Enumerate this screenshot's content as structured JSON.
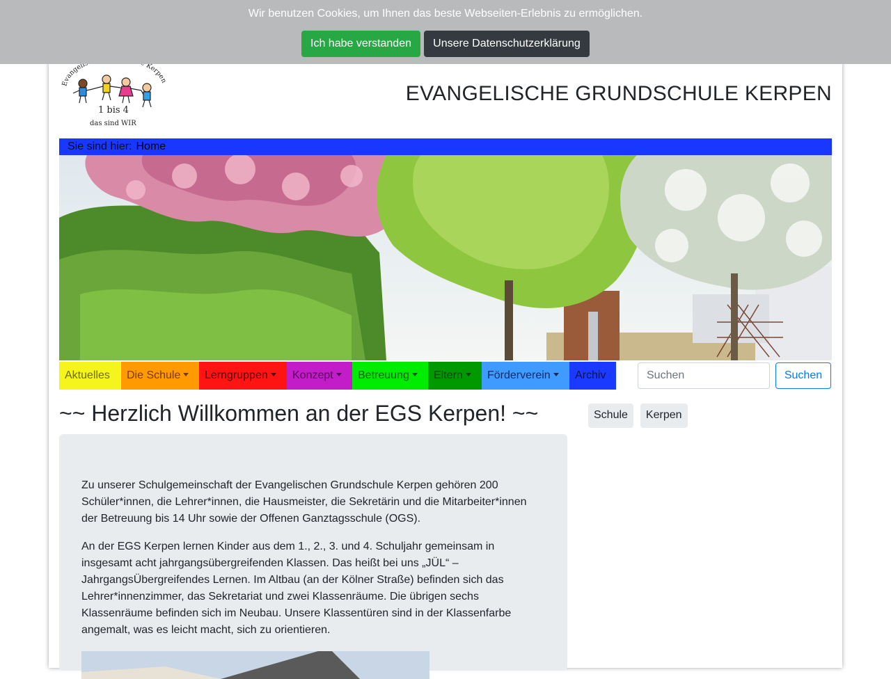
{
  "cookie": {
    "message": "Wir benutzen Cookies, um Ihnen das beste Webseiten-Erlebnis zu ermöglichen.",
    "accept_label": "Ich habe verstanden",
    "privacy_label": "Unsere Datenschutzerklärung",
    "colors": {
      "accept": "#28a745",
      "privacy": "#343a40",
      "bar": "#b9babc"
    }
  },
  "header": {
    "title": "EVANGELISCHE GRUNDSCHULE KERPEN",
    "logo": {
      "ring_text": "Evangelische Grundschule Kerpen",
      "line1": "1 bis 4",
      "line2": "das sind WIR"
    }
  },
  "breadcrumb": {
    "label": "Sie sind hier:",
    "current": "Home",
    "color": "#1837ff"
  },
  "nav": {
    "items": [
      {
        "label": "Aktuelles",
        "dropdown": false,
        "bg": "#f5f51d",
        "fg": "#6b6b00"
      },
      {
        "label": "Die Schule",
        "dropdown": true,
        "bg": "#ff9a00",
        "fg": "#7a3a00"
      },
      {
        "label": "Lerngruppen",
        "dropdown": true,
        "bg": "#ff1414",
        "fg": "#5a0000"
      },
      {
        "label": "Konzept",
        "dropdown": true,
        "bg": "#c31cc9",
        "fg": "#5a005e"
      },
      {
        "label": "Betreuung",
        "dropdown": true,
        "bg": "#00ec00",
        "fg": "#006200"
      },
      {
        "label": "Eltern",
        "dropdown": true,
        "bg": "#009a00",
        "fg": "#004400"
      },
      {
        "label": "Förderverein",
        "dropdown": true,
        "bg": "#3f9bff",
        "fg": "#0d2c66"
      },
      {
        "label": "Archiv",
        "dropdown": false,
        "bg": "#1a3bff",
        "fg": "#0a1150"
      }
    ],
    "search": {
      "placeholder": "Suchen",
      "button_label": "Suchen"
    }
  },
  "main": {
    "heading": "~~ Herzlich Willkommen an der EGS Kerpen! ~~",
    "paragraphs": [
      "Zu unserer Schulgemeinschaft der Evangelischen Grundschule Kerpen gehören 200 Schüler*innen, die Lehrer*innen, die Hausmeister, die Sekretärin und die Mitarbeiter*innen der Betreuung bis 14 Uhr sowie der Offenen Ganztagsschule (OGS).",
      "An der EGS Kerpen lernen Kinder aus dem 1., 2., 3. und 4. Schuljahr gemeinsam in insgesamt acht jahrgangsübergreifenden Klassen. Das heißt bei uns „JÜL“ – JahrgangsÜbergreifendes Lernen.  Im Altbau (an der Kölner Straße) befinden sich das Lehrer*innenzimmer, das Sekretariat und zwei Klassenräume. Die übrigen sechs Klassenräume befinden sich im Neubau. Unsere Klassentüren sind in der Klassenfarbe angemalt, was es leicht macht, sich zu orientieren."
    ]
  },
  "tags": [
    "Schule",
    "Kerpen"
  ]
}
